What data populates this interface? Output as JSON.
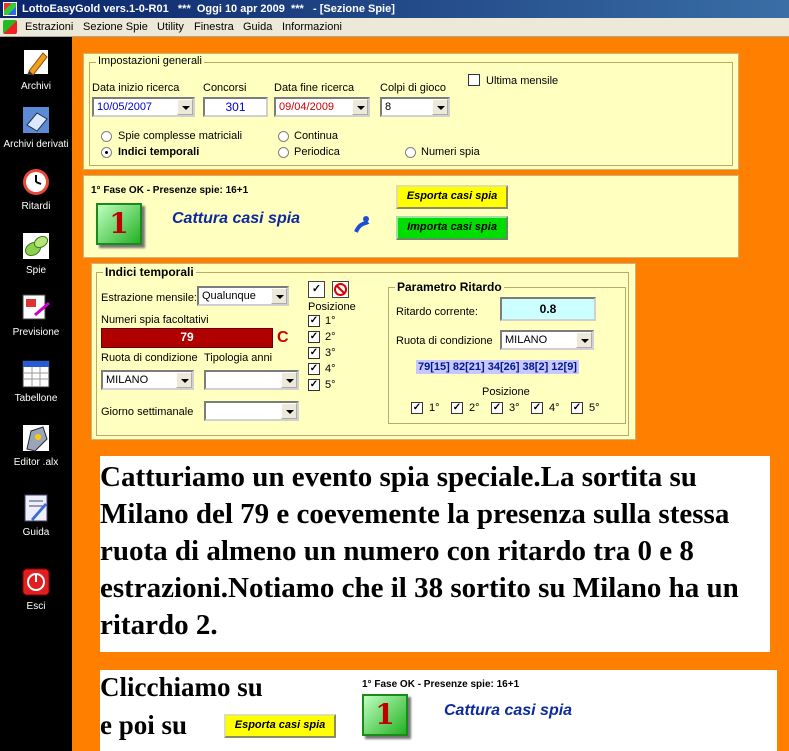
{
  "window": {
    "title": "LottoEasyGold vers.1-0-R01   ***  Oggi 10 apr 2009  ***   - [Sezione Spie]"
  },
  "menu": [
    "Estrazioni",
    "Sezione Spie",
    "Utility",
    "Finestra",
    "Guida",
    "Informazioni"
  ],
  "sidebar": {
    "items": [
      {
        "label": "Archivi",
        "icon": "pencil-icon"
      },
      {
        "label": "Archivi derivati",
        "icon": "book-icon"
      },
      {
        "label": "Ritardi",
        "icon": "clock-icon"
      },
      {
        "label": "Spie",
        "icon": "spyglass-icon"
      },
      {
        "label": "Previsione",
        "icon": "forecast-icon"
      },
      {
        "label": "Tabellone",
        "icon": "grid-icon"
      },
      {
        "label": "Editor .alx",
        "icon": "editor-icon"
      },
      {
        "label": "Guida",
        "icon": "guide-icon"
      },
      {
        "label": "Esci",
        "icon": "exit-icon"
      }
    ]
  },
  "impostazioni": {
    "title": "Impostazioni generali",
    "data_inizio_label": "Data inizio ricerca",
    "data_inizio_value": "10/05/2007",
    "concorsi_label": "Concorsi",
    "concorsi_value": "301",
    "data_fine_label": "Data fine ricerca",
    "data_fine_value": "09/04/2009",
    "colpi_label": "Colpi di gioco",
    "colpi_value": "8",
    "ultima_mensile": "Ultima mensile",
    "radio_spie_complesse": "Spie complesse matriciali",
    "radio_indici_temporali": "Indici temporali",
    "radio_continua": "Continua",
    "radio_periodica": "Periodica",
    "radio_numeri_spia": "Numeri spia"
  },
  "fase": {
    "status": "1° Fase OK - Presenze spie: 16+1",
    "digit": "1",
    "cattura": "Cattura casi spia",
    "esporta": "Esporta casi spia",
    "importa": "Importa casi spia"
  },
  "indici": {
    "title": "Indici temporali",
    "estrazione_label": "Estrazione mensile:",
    "estrazione_value": "Qualunque",
    "numeri_spia_label": "Numeri spia facoltativi",
    "numeri_spia_value": "79",
    "c_marker": "C",
    "ruota_label": "Ruota di condizione",
    "ruota_value": "MILANO",
    "tipologia_label": "Tipologia anni",
    "tipologia_value": "",
    "giorno_label": "Giorno settimanale",
    "giorno_value": "",
    "check_mark": "✓",
    "posizione_label": "Posizione",
    "posizioni": [
      "1°",
      "2°",
      "3°",
      "4°",
      "5°"
    ]
  },
  "parametro": {
    "title": "Parametro Ritardo",
    "ritardo_label": "Ritardo corrente:",
    "ritardo_value": "0.8",
    "ruota_label": "Ruota di condizione",
    "ruota_value": "MILANO",
    "ritardi_list": "79[15] 82[21] 34[26] 38[2] 12[9]",
    "posizione_label": "Posizione",
    "posizioni": [
      "1°",
      "2°",
      "3°",
      "4°",
      "5°"
    ]
  },
  "caption": {
    "text": "Catturiamo un evento spia speciale.La sortita su Milano del 79 e coevemente la presenza sulla stessa ruota di almeno un numero con ritardo tra 0 e 8 estrazioni.Notiamo che il 38 sortito su Milano ha un ritardo 2."
  },
  "caption2": {
    "line1": "Clicchiamo su",
    "line2": "e poi su",
    "status": "1° Fase OK - Presenze spie: 16+1",
    "esporta": "Esporta casi spia",
    "digit": "1",
    "cattura": "Cattura casi spia"
  },
  "colors": {
    "titlebar": "#0a246a",
    "main_bg": "#ff7f00",
    "panel_bg": "#ffffc0",
    "spia_field_bg": "#b00000",
    "ritardo_field_bg": "#ccffff",
    "export_button": "#ffff00",
    "import_button": "#00dd00"
  }
}
